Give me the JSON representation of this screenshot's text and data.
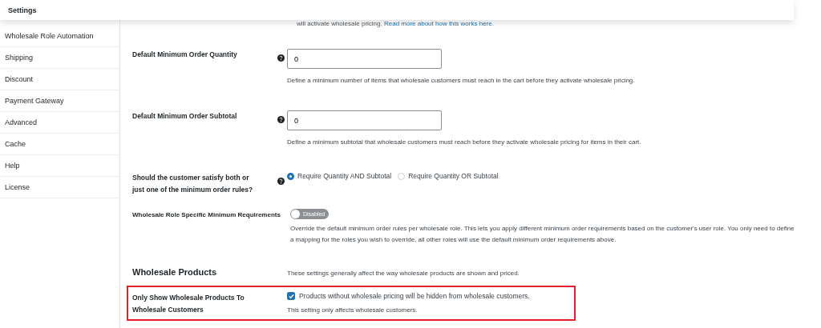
{
  "header": {
    "title": "Settings"
  },
  "top_note": {
    "text": "will activate wholesale pricing.",
    "link": "Read more about how this works here",
    "end": "."
  },
  "sidebar": {
    "items": [
      {
        "label": "Wholesale Role Automation",
        "selected": false
      },
      {
        "label": "Shipping",
        "selected": false
      },
      {
        "label": "Discount",
        "selected": false
      },
      {
        "label": "Payment Gateway",
        "selected": false
      },
      {
        "label": "Advanced",
        "selected": false
      },
      {
        "label": "Cache",
        "selected": false
      },
      {
        "label": "Help",
        "selected": false
      },
      {
        "label": "License",
        "selected": false
      }
    ]
  },
  "settings": [
    {
      "kind": "number",
      "label": "Default Minimum Order Quantity",
      "help": true,
      "value": "0",
      "description": "Define a minimum number of items that wholesale customers must reach in the cart before they activate wholesale pricing.",
      "highlighted": false
    },
    {
      "kind": "number",
      "label": "Default Minimum Order Subtotal",
      "help": true,
      "value": "0",
      "description": "Define a minimum subtotal that wholesale customers must reach before they activate wholesale pricing for items in their cart.",
      "highlighted": false
    },
    {
      "kind": "radio",
      "label": "Should the customer satisfy both or just one of the minimum order rules?",
      "help": true,
      "options": [
        {
          "label": "Require Quantity AND Subtotal",
          "selected": true
        },
        {
          "label": "Require Quantity OR Subtotal",
          "selected": false
        }
      ],
      "highlighted": false
    },
    {
      "kind": "toggle",
      "label": "Wholesale Role Specific Minimum Requirements",
      "help": false,
      "on": false,
      "state_label": "Disabled",
      "description": "Override the default minimum order rules per wholesale role. This lets you apply different minimum order requirements based on the customer's user role. You only need to define a mapping for the roles you wish to override, all other roles will use the default minimum order requirements above.",
      "highlighted": false
    },
    {
      "kind": "heading",
      "label": "Wholesale Products",
      "description": "These settings generally affect the way wholesale products are shown and priced.",
      "highlighted": false
    },
    {
      "kind": "checkbox",
      "label": "Only Show Wholesale Products To Wholesale Customers",
      "help": false,
      "checked": true,
      "check_label": "Products without wholesale pricing will be hidden from wholesale customers.",
      "description": "This setting only affects wholesale customers.",
      "highlighted": true
    }
  ]
}
